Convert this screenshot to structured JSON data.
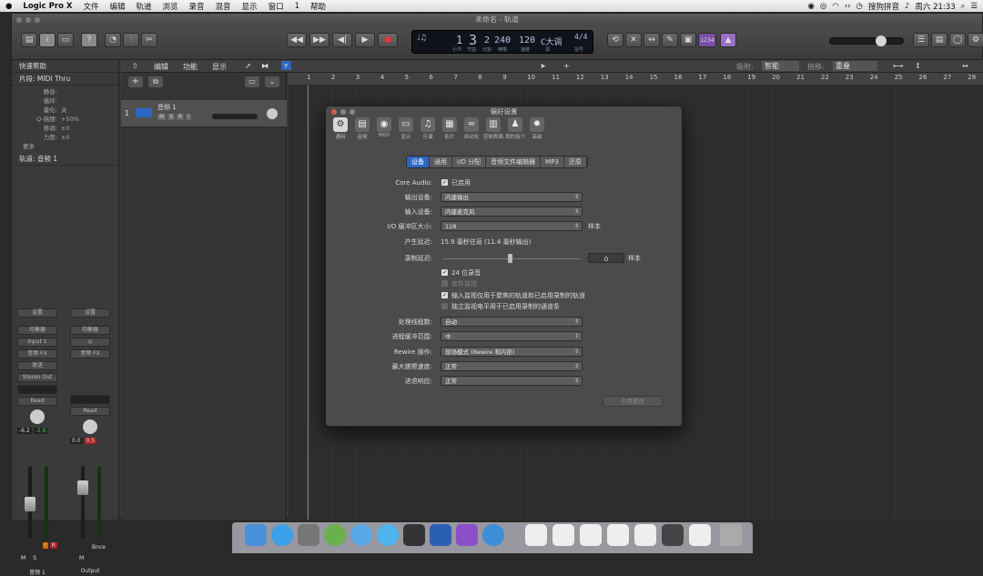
{
  "menubar": {
    "apple": "",
    "app": "Logic Pro X",
    "items": [
      "文件",
      "编辑",
      "轨道",
      "浏览",
      "录音",
      "混音",
      "显示",
      "窗口",
      "1",
      "帮助"
    ],
    "input_method": "搜狗拼音",
    "sync": "",
    "day_time": "周六 21:33"
  },
  "window": {
    "title": "未命名 - 轨道"
  },
  "lcd": {
    "bar": "1",
    "beat": "3",
    "div": "2",
    "tick": "240",
    "tempo": "120",
    "key": "C大调",
    "sig": "4/4",
    "labels": [
      "小节",
      "节拍",
      "分割",
      "嘀嗒",
      "速度",
      "调",
      "拍号"
    ]
  },
  "toolbar": {
    "cpu_label": "1234"
  },
  "editbar": {
    "menus": [
      "编辑",
      "功能",
      "显示"
    ],
    "snap_label": "吸附:",
    "snap_value": "智能",
    "drag_label": "拖移:",
    "drag_value": "重叠"
  },
  "inspector": {
    "quick_help": "快速帮助",
    "region": "片段: MIDI Thru",
    "params": [
      {
        "k": "静音:",
        "v": ""
      },
      {
        "k": "循环:",
        "v": ""
      },
      {
        "k": "量化:",
        "v": "关"
      },
      {
        "k": "Q-摇摆:",
        "v": "+50%"
      },
      {
        "k": "移调:",
        "v": "±0"
      },
      {
        "k": "力度:",
        "v": "±0"
      }
    ],
    "more": "更多",
    "track": "轨道: 音频 1"
  },
  "strips": [
    {
      "name": "音频 1",
      "input": "Input 1",
      "out": "Stereo Out",
      "mode": "Read",
      "v1": "-6.2",
      "v2": "-2.6",
      "btns": [
        "设置",
        "均衡器",
        "音频 FX",
        "发送"
      ]
    },
    {
      "name": "Output",
      "mode": "Read",
      "v1": "0.0",
      "v2": "0.5",
      "btns": [
        "设置",
        "均衡器",
        "音频 FX"
      ],
      "bnce": "Bnce"
    }
  ],
  "track": {
    "num": "1",
    "name": "音频 1",
    "buttons": [
      "M",
      "S",
      "R",
      "I"
    ]
  },
  "ruler": [
    "1",
    "2",
    "3",
    "4",
    "5",
    "6",
    "7",
    "8",
    "9",
    "10",
    "11",
    "12",
    "13",
    "14",
    "15",
    "16",
    "17",
    "18",
    "19",
    "20",
    "21",
    "22",
    "23",
    "24",
    "25",
    "26",
    "27",
    "28"
  ],
  "dialog": {
    "title": "偏好设置",
    "tabs": [
      {
        "label": "通用",
        "ic": "⚙"
      },
      {
        "label": "音频",
        "ic": "▤"
      },
      {
        "label": "MIDI",
        "ic": "◉"
      },
      {
        "label": "显示",
        "ic": "▭"
      },
      {
        "label": "乐谱",
        "ic": "♫"
      },
      {
        "label": "影片",
        "ic": "▦"
      },
      {
        "label": "自动化",
        "ic": "≈"
      },
      {
        "label": "控制表面",
        "ic": "▥"
      },
      {
        "label": "我的简介",
        "ic": "♟"
      },
      {
        "label": "高级",
        "ic": "✹"
      }
    ],
    "subtabs": [
      "设备",
      "通用",
      "I/O 分配",
      "音频文件编辑器",
      "MP3",
      "还原"
    ],
    "core_audio_label": "Core Audio:",
    "core_audio_value": "已启用",
    "output_label": "输出设备:",
    "output_value": "内建输出",
    "input_label": "输入设备:",
    "input_value": "内建麦克风",
    "buffer_label": "I/O 缓冲区大小:",
    "buffer_value": "128",
    "buffer_unit": "样本",
    "latency_label": "产生延迟:",
    "latency_value": "15.9 毫秒往返 (11.4 毫秒输出)",
    "rec_delay_label": "录制延迟:",
    "rec_delay_value": "0",
    "rec_delay_unit": "样本",
    "checks": [
      {
        "t": "24 位录音",
        "on": true
      },
      {
        "t": "软件监视",
        "on": false
      },
      {
        "t": "输入监视仅用于聚焦的轨道和已启用录制的轨道",
        "on": true
      },
      {
        "t": "独立监视电平用于已启用录制的通道条",
        "on": false
      }
    ],
    "threads_label": "处理线程数:",
    "threads_value": "自动",
    "proc_label": "进程缓冲范围:",
    "proc_value": "中",
    "rewire_label": "Rewire 操作:",
    "rewire_value": "现场模式 (Rewire 和内部)",
    "scrub_label": "最大搓擦速度:",
    "scrub_value": "正常",
    "scroll_label": "进退响应:",
    "scroll_value": "正常",
    "apply": "应用更改"
  }
}
